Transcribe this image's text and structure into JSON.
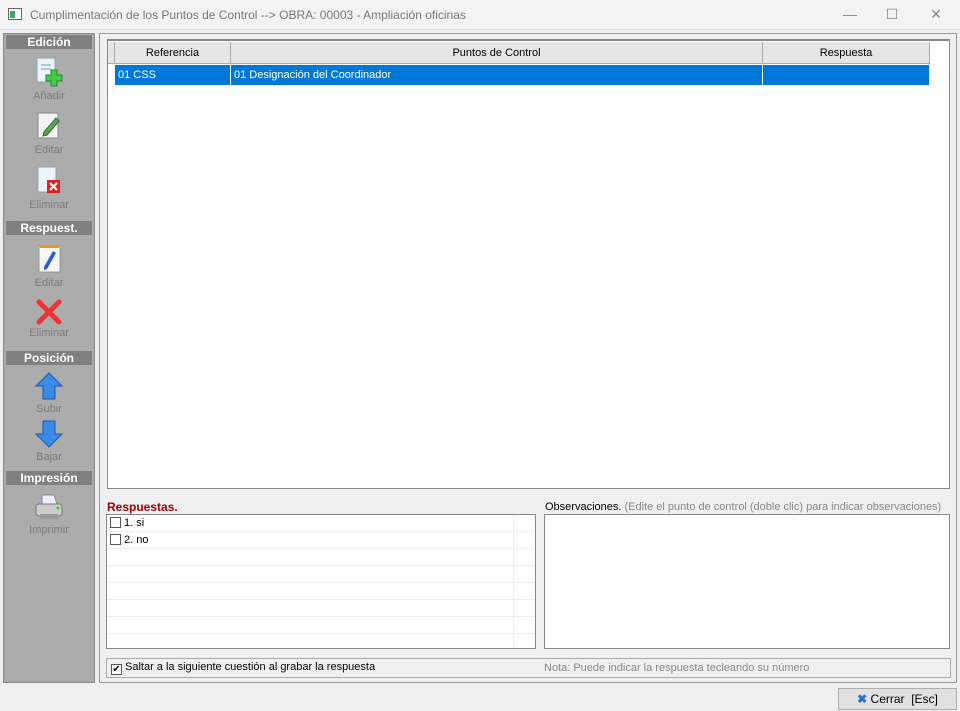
{
  "window": {
    "title": "Cumplimentación de los Puntos de Control --> OBRA: 00003 - Ampliación oficinas"
  },
  "sidebar": {
    "sections": [
      {
        "label": "Edición",
        "items": [
          {
            "label": "Añadir",
            "icon": "add-document-icon"
          },
          {
            "label": "Editar",
            "icon": "edit-document-icon"
          },
          {
            "label": "Eliminar",
            "icon": "delete-document-icon"
          }
        ]
      },
      {
        "label": "Respuest.",
        "items": [
          {
            "label": "Editar",
            "icon": "edit-pen-icon"
          },
          {
            "label": "Eliminar",
            "icon": "red-x-icon"
          }
        ]
      },
      {
        "label": "Posición",
        "items": [
          {
            "label": "Subir",
            "icon": "arrow-up-icon"
          },
          {
            "label": "Bajar",
            "icon": "arrow-down-icon"
          }
        ]
      },
      {
        "label": "Impresión",
        "items": [
          {
            "label": "Imprimir",
            "icon": "printer-icon"
          }
        ]
      }
    ]
  },
  "grid": {
    "columns": [
      "Referencia",
      "Puntos de Control",
      "Respuesta"
    ],
    "rows": [
      {
        "referencia": "01 CSS",
        "punto": "01 Designación del Coordinador",
        "respuesta": "",
        "selected": true
      }
    ]
  },
  "respuestas": {
    "label": "Respuestas.",
    "items": [
      {
        "label": "1. si",
        "checked": false
      },
      {
        "label": "2. no",
        "checked": false
      }
    ]
  },
  "observaciones": {
    "label": "Observaciones.",
    "hint": "(Edite el punto de control (doble clic) para indicar observaciones)",
    "value": ""
  },
  "options": {
    "jump_label": "Saltar a la siguiente cuestión al grabar la respuesta",
    "jump_checked": true,
    "check_mark": "✔",
    "nota": "Nota: Puede indicar la respuesta tecleando su número"
  },
  "footer": {
    "close_label": "Cerrar  [Esc]"
  },
  "colors": {
    "selection": "#0078d7",
    "respuestas_label": "#a00000",
    "sidebar": "#ababab"
  }
}
